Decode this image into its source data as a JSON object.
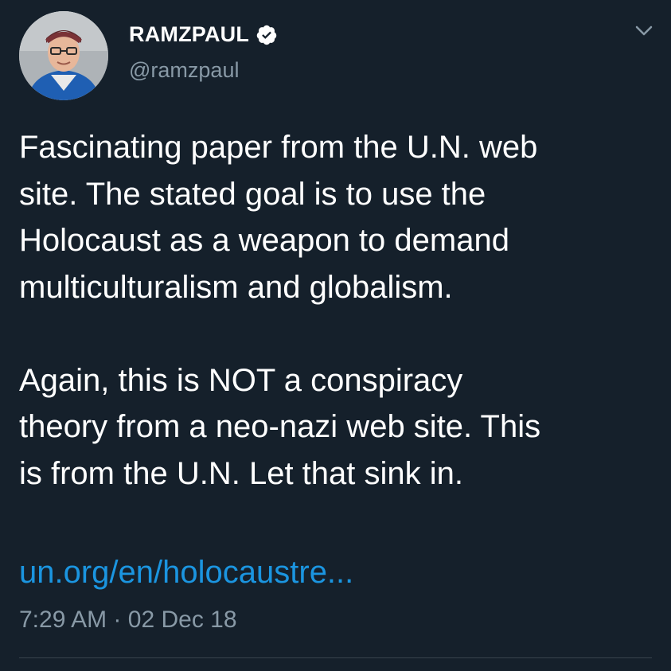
{
  "author": {
    "display_name": "RAMZPAUL",
    "handle": "@ramzpaul",
    "verified": true,
    "avatar": "avatar-photo"
  },
  "tweet": {
    "paragraph_1": "Fascinating paper from the U.N. web\nsite. The stated goal is to use the\nHolocaust as a weapon to demand\nmulticulturalism and globalism.",
    "paragraph_2": "Again, this is NOT a conspiracy\ntheory from a neo-nazi web site. This\nis from the U.N. Let that sink in.",
    "link_text": "un.org/en/holocaustre..."
  },
  "meta": {
    "time": "7:29 AM",
    "separator": "·",
    "date": "02 Dec 18"
  },
  "icons": {
    "verified": "verified-badge-icon",
    "menu": "chevron-down-icon"
  },
  "colors": {
    "background": "#15202b",
    "text": "#ffffff",
    "secondary_text": "#8899a6",
    "link": "#1b95e0",
    "verified_badge": "#ffffff"
  }
}
